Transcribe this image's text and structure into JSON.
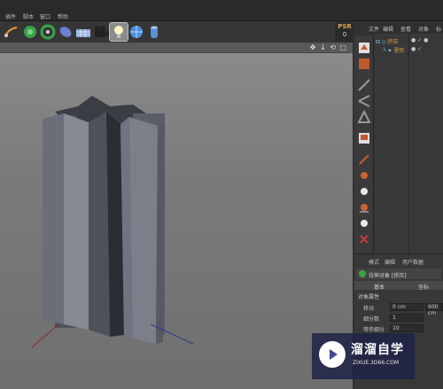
{
  "menu": {
    "items": [
      "插件",
      "脚本",
      "窗口",
      "帮助"
    ]
  },
  "psr": {
    "label": "PSR",
    "value": "0"
  },
  "object_manager": {
    "tabs": [
      "文件",
      "编辑",
      "查看",
      "对象",
      "标"
    ],
    "objects": [
      {
        "name": "挤压",
        "icon": "extrude-icon",
        "color": "#e0a64a"
      },
      {
        "name": "星形",
        "icon": "spline-star-icon",
        "color": "#e0a64a"
      }
    ]
  },
  "attributes": {
    "tabs": [
      "模式",
      "编辑",
      "用户数据"
    ],
    "object_title": "拉伸对象 [挤压]",
    "modes": [
      "基本",
      "坐标"
    ],
    "section_title": "对象属性",
    "params": [
      {
        "label": "移动",
        "value": "0 cm",
        "value2": "600 cm"
      },
      {
        "label": "细分数",
        "value": "1",
        "value2": ""
      },
      {
        "label": "等参细分",
        "value": "10",
        "value2": ""
      }
    ]
  },
  "watermark": {
    "title": "溜溜自学",
    "subtitle": "ZIXUE.3D66.COM"
  },
  "colors": {
    "accent": "#e0a64a",
    "viewport_bg": "#7d7d7d",
    "panel_bg": "#383838"
  }
}
